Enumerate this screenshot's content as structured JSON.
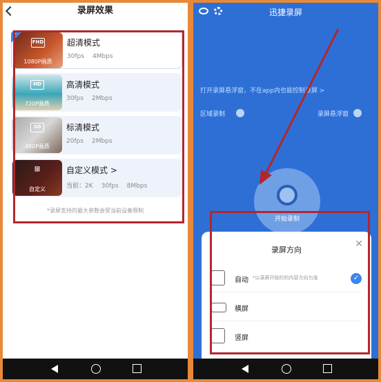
{
  "left": {
    "title": "录屏效果",
    "modes": [
      {
        "title": "超清模式",
        "badge": "FHD",
        "quality": "1080P画质",
        "fps": "30fps",
        "bitrate": "4Mbps"
      },
      {
        "title": "高清模式",
        "badge": "HD",
        "quality": "720P画质",
        "fps": "30fps",
        "bitrate": "2Mbps"
      },
      {
        "title": "标清模式",
        "badge": "SD",
        "quality": "480P画质",
        "fps": "20fps",
        "bitrate": "2Mbps"
      },
      {
        "title": "自定义模式  >",
        "badge": "",
        "quality": "自定义",
        "fps": "当前：2K",
        "bitrate": "30fps",
        "extra": "8Mbps"
      }
    ],
    "note": "*录屏支持的最大参数会受当前设备限制"
  },
  "right": {
    "title": "迅捷录屏",
    "tip": "打开录屏悬浮窗，不在app内也能控制录屏 >",
    "region_label": "区域录制",
    "float_label": "录屏悬浮窗",
    "start_label": "开始录制",
    "sheet": {
      "title": "录屏方向",
      "options": [
        {
          "label": "自动",
          "note": "*以录屏开始时的内容方向为准",
          "selected": true
        },
        {
          "label": "横屏"
        },
        {
          "label": "竖屏"
        }
      ]
    }
  },
  "colors": {
    "accent": "#3a86f0",
    "annotation_red": "#b3262b",
    "bg_blue": "#2e6fd6"
  }
}
